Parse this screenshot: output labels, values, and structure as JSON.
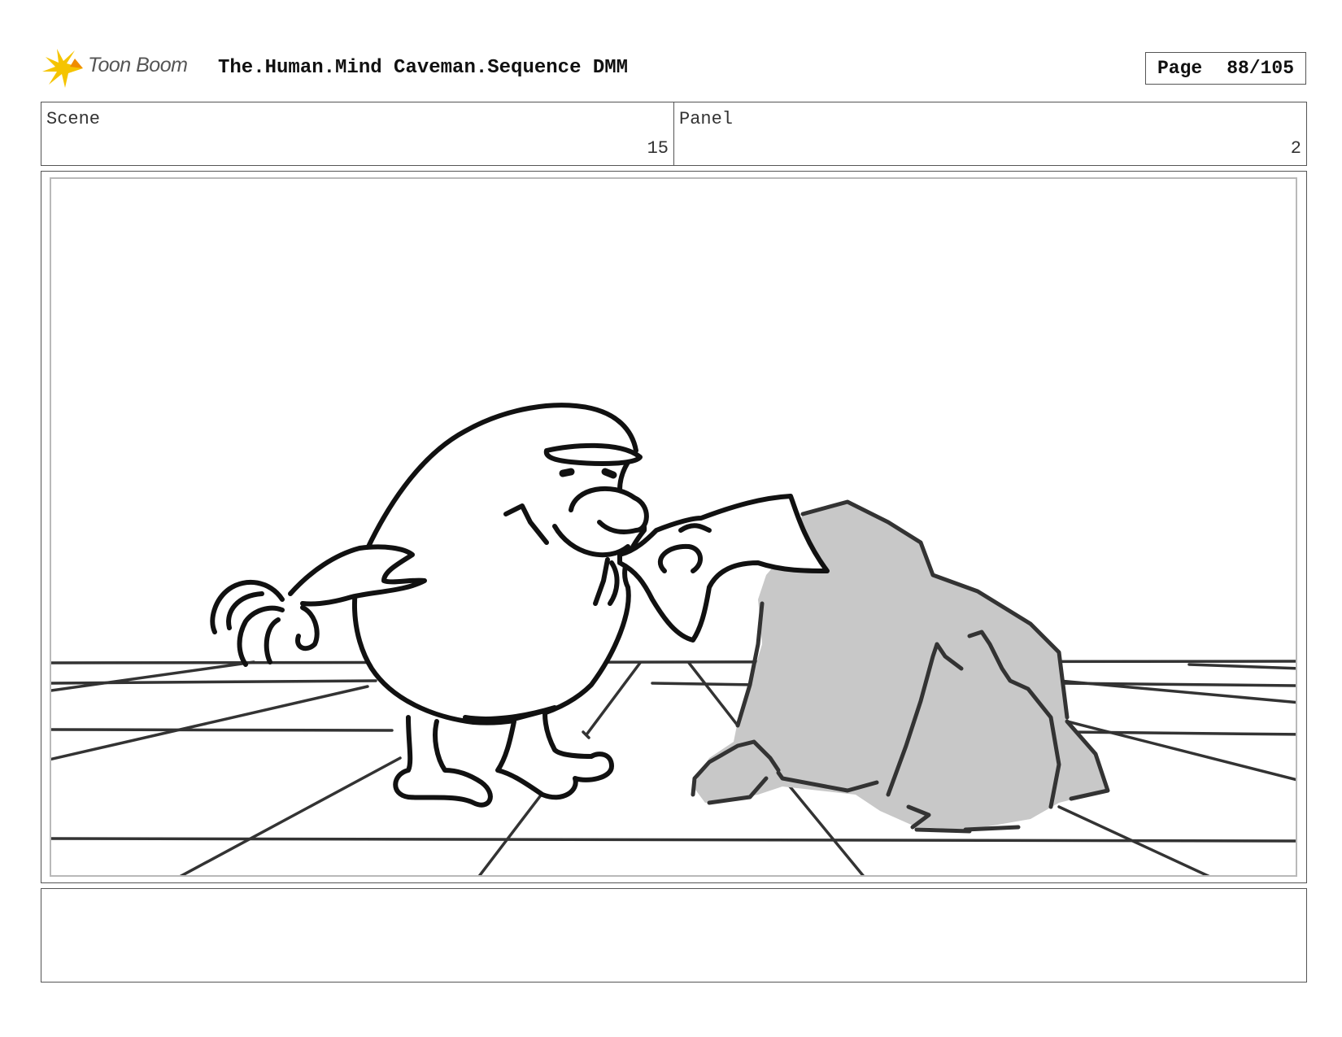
{
  "header": {
    "logo_text": "Toon Boom",
    "title": "The.Human.Mind Caveman.Sequence DMM",
    "page_label": "Page",
    "page_value": "88/105"
  },
  "info": {
    "scene_label": "Scene",
    "scene_value": "15",
    "panel_label": "Panel",
    "panel_value": "2"
  },
  "colors": {
    "logo_accent": "#f5c400",
    "rock_fill": "#c8c8c8",
    "ink": "#111111"
  },
  "notes": {
    "text": ""
  }
}
